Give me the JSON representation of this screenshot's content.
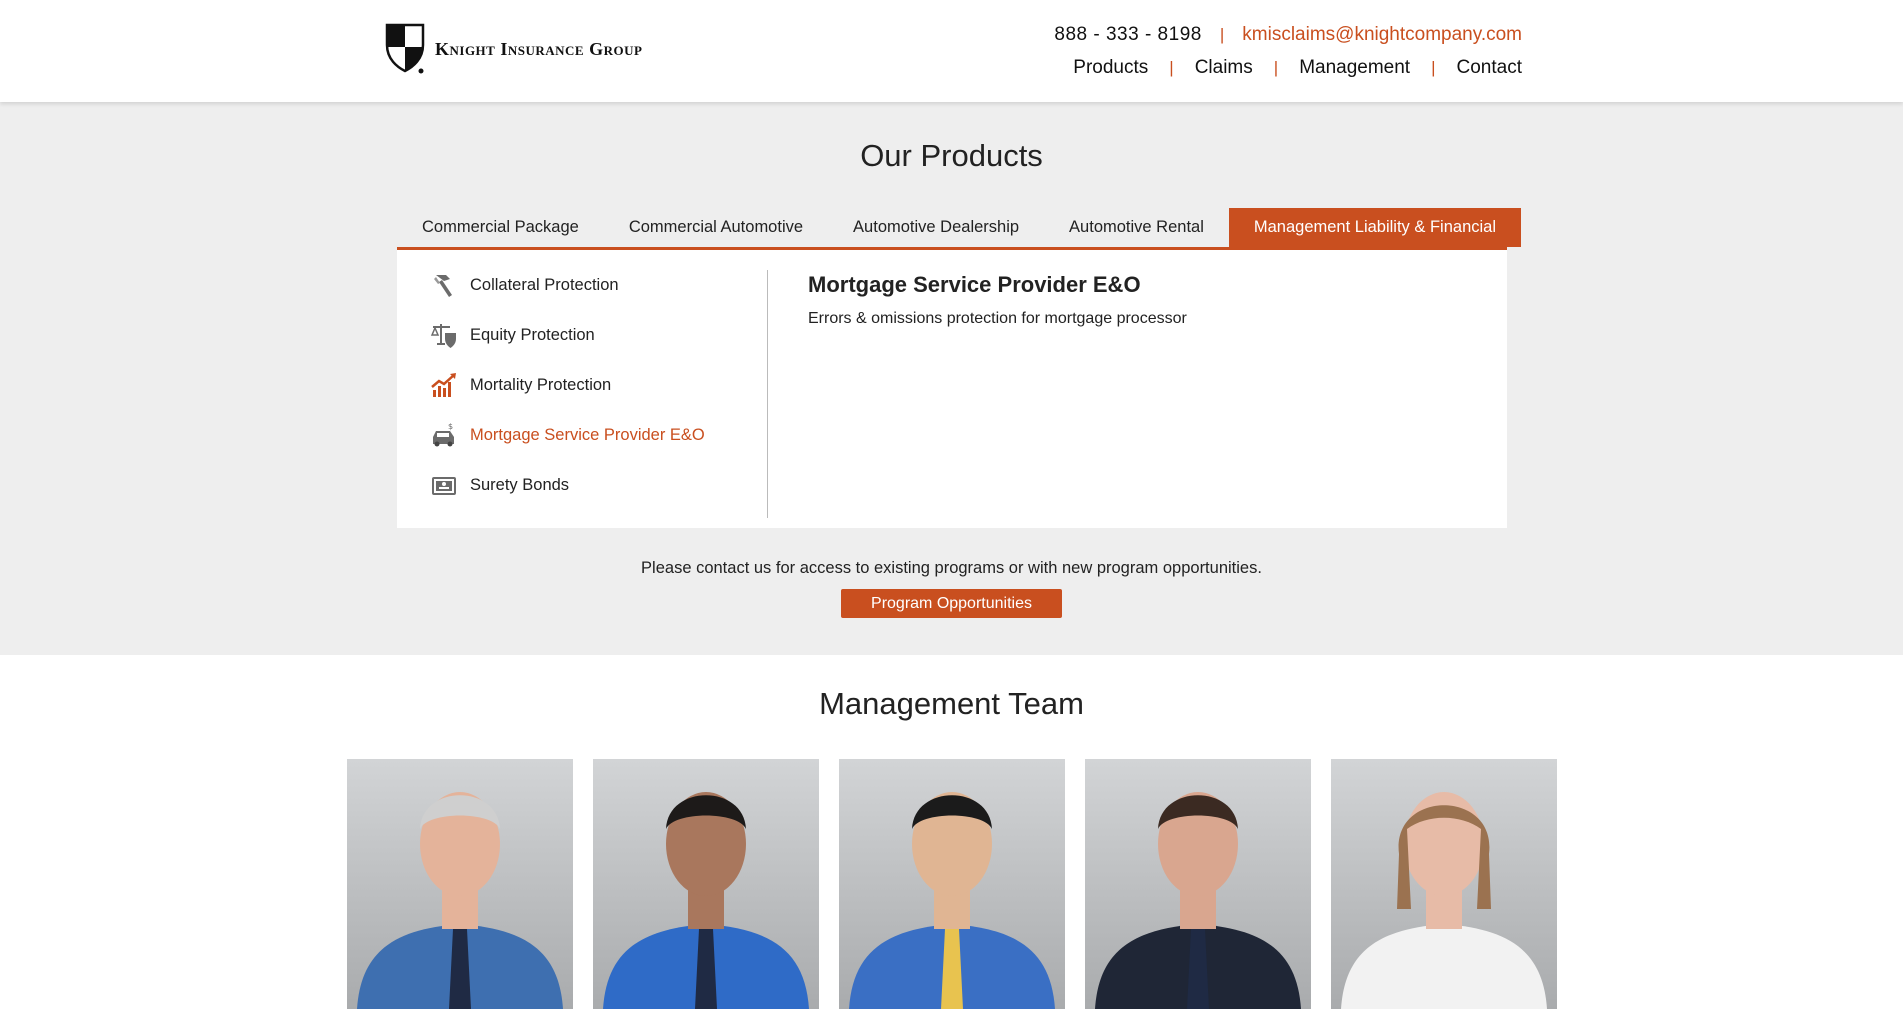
{
  "header": {
    "logo_text": "Knight Insurance Group",
    "phone": "888 - 333 - 8198",
    "email": "kmisclaims@knightcompany.com",
    "nav": [
      "Products",
      "Claims",
      "Management",
      "Contact"
    ]
  },
  "products": {
    "title": "Our Products",
    "tabs": [
      "Commercial Package",
      "Commercial Automotive",
      "Automotive Dealership",
      "Automotive Rental",
      "Management Liability & Financial"
    ],
    "active_tab": "Management Liability & Financial",
    "items": [
      {
        "label": "Collateral Protection",
        "icon": "hammer-icon"
      },
      {
        "label": "Equity Protection",
        "icon": "scales-shield-icon"
      },
      {
        "label": "Mortality Protection",
        "icon": "rising-chart-icon"
      },
      {
        "label": "Mortgage Service Provider E&O",
        "icon": "car-dollar-icon"
      },
      {
        "label": "Surety Bonds",
        "icon": "bond-certificate-icon"
      }
    ],
    "active_item": "Mortgage Service Provider E&O",
    "detail": {
      "title": "Mortgage Service Provider E&O",
      "description": "Errors & omissions protection for mortgage processor"
    },
    "contact_note": "Please contact us for access to existing programs or with new program opportunities.",
    "cta_label": "Program Opportunities"
  },
  "team": {
    "title": "Management Team",
    "members": [
      {
        "shirt": "#3e6fb0",
        "hair": "#cfcfcf",
        "skin": "#e4b39a"
      },
      {
        "shirt": "#2f6bc7",
        "hair": "#1d1a19",
        "skin": "#a9775d"
      },
      {
        "shirt": "#3a6fc4",
        "hair": "#1b1b1b",
        "skin": "#e0b593"
      },
      {
        "shirt": "#1f2636",
        "hair": "#3b2a22",
        "skin": "#d9a68f"
      },
      {
        "shirt": "#f2f2f2",
        "hair": "#9b7250",
        "skin": "#e7bba7"
      }
    ]
  },
  "colors": {
    "accent": "#c94f1f",
    "section_bg": "#eeeeee"
  }
}
